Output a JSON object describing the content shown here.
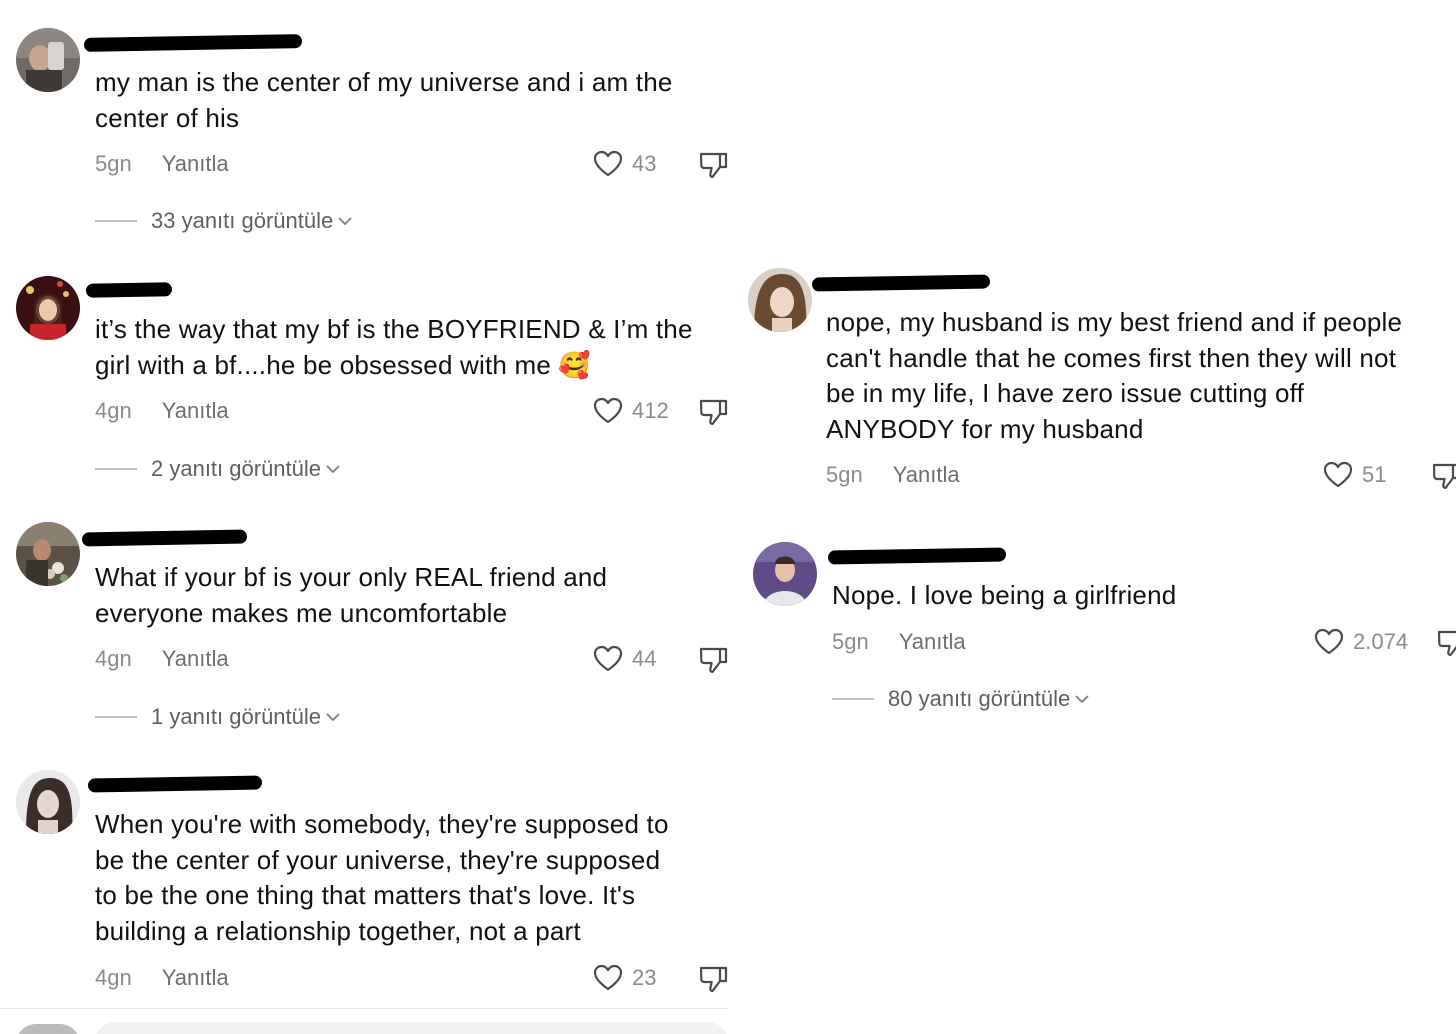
{
  "left_comments": [
    {
      "text_lines": [
        "my man is the center of my universe and i am the",
        "center of his"
      ],
      "age": "5gn",
      "reply_label": "Yanıtla",
      "likes": "43",
      "view_replies": "33 yanıtı görüntüle"
    },
    {
      "text_lines": [
        "it’s the way that my bf is the BOYFRIEND & I’m the",
        "girl with a bf....he be obsessed with me 🥰"
      ],
      "age": "4gn",
      "reply_label": "Yanıtla",
      "likes": "412",
      "view_replies": "2 yanıtı görüntüle"
    },
    {
      "text_lines": [
        "What if your bf is your only REAL friend and",
        "everyone makes me uncomfortable"
      ],
      "age": "4gn",
      "reply_label": "Yanıtla",
      "likes": "44",
      "view_replies": "1 yanıtı görüntüle"
    },
    {
      "text_lines": [
        "When you're with somebody, they're supposed to",
        "be the center of your universe, they're supposed",
        "to be the one thing that matters that's love. It's",
        "building a relationship together, not a part"
      ],
      "age": "4gn",
      "reply_label": "Yanıtla",
      "likes": "23"
    }
  ],
  "right_comments": [
    {
      "text_lines": [
        "nope, my husband is my best friend and if people",
        "can't handle that he comes first then they will not",
        "be in my life, I have zero issue cutting off",
        "ANYBODY for my husband"
      ],
      "age": "5gn",
      "reply_label": "Yanıtla",
      "likes": "51"
    },
    {
      "text_lines": [
        "Nope. I love being a girlfriend"
      ],
      "age": "5gn",
      "reply_label": "Yanıtla",
      "likes": "2.074",
      "view_replies": "80 yanıtı görüntüle"
    }
  ],
  "icons": {
    "like": "heart-outline-icon",
    "dislike": "thumbs-down-icon",
    "expand": "chevron-down-icon"
  },
  "colors": {
    "text": "#111111",
    "muted": "#8a8b91",
    "redaction": "#000000"
  }
}
